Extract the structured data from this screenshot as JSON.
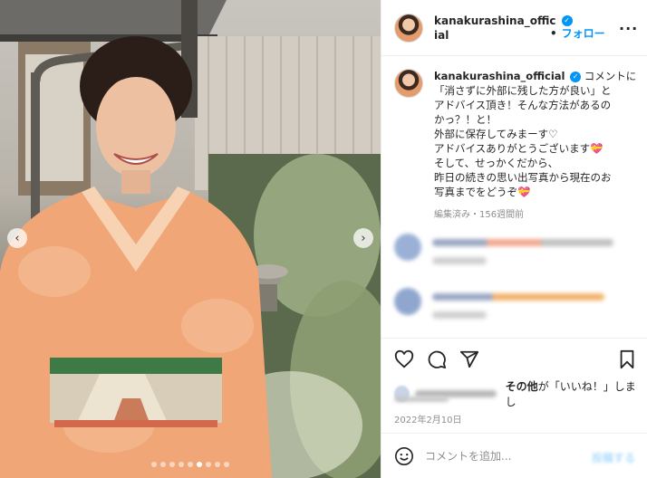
{
  "post": {
    "carousel": {
      "slide_count": 9,
      "active_index": 5,
      "prev_icon": "chevron-left-icon",
      "next_icon": "chevron-right-icon"
    },
    "header": {
      "username_line1": "kanakurashina_offic",
      "username_line2": "ial",
      "verified_icon": "verified-badge-icon",
      "separator": "•",
      "follow_label": "フォロー",
      "more_label": "···"
    },
    "caption": {
      "username": "kanakurashina_official",
      "lines": [
        "コメントに",
        "「消さずに外部に残した方が良い」と",
        "アドバイス頂き！そんな方法があるの",
        "かっ？！と！",
        "外部に保存してみまーす♡",
        "アドバイスありがとうございます💝",
        "そして、せっかくだから、",
        "昨日の続きの思い出写真から現在のお",
        "写真までをどうぞ💝"
      ],
      "meta": "編集済み・156週間前"
    },
    "actions": {
      "like_icon": "heart-icon",
      "comment_icon": "comment-icon",
      "share_icon": "send-icon",
      "save_icon": "bookmark-icon"
    },
    "likes": {
      "prefix": "その他",
      "suffix": "が「いいね！」しまし",
      "cont": "た"
    },
    "date": "2022年2月10日",
    "composer": {
      "placeholder": "コメントを追加...",
      "post_label": "投稿する",
      "emoji_icon": "smiley-icon"
    },
    "colors": {
      "accent": "#0095f6",
      "text": "#262626",
      "muted": "#8e8e8e",
      "border": "#efefef"
    }
  }
}
